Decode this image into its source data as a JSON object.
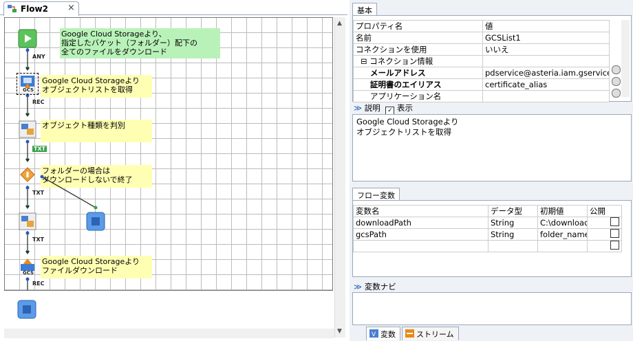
{
  "editor": {
    "tab_label": "Flow2",
    "tab_close": "×"
  },
  "flow": {
    "notes": [
      {
        "text": "Google Cloud Storageより、\n指定したバケット（フォルダー）配下の\n全てのファイルをダウンロード",
        "color": "#b9f2b9"
      },
      {
        "text": "Google Cloud Storageより\nオブジェクトリストを取得",
        "color": "#ffffb3"
      },
      {
        "text": "オブジェクト種類を判別",
        "color": "#ffffb3"
      },
      {
        "text": "フォルダーの場合は\nダウンロードしないで終了",
        "color": "#ffffb3"
      },
      {
        "text": "Google Cloud Storageより\nファイルダウンロード",
        "color": "#ffffb3"
      }
    ],
    "stream_labels": [
      "ANY",
      "REC",
      "TXT",
      "TXT",
      "TXT",
      "REC"
    ],
    "component_labels": [
      "GCS",
      "GCS"
    ]
  },
  "properties": {
    "tab": "基本",
    "header": [
      "プロパティ名",
      "値"
    ],
    "rows": [
      {
        "name": "名前",
        "value": "GCSList1"
      },
      {
        "name": "コネクションを使用",
        "value": "いいえ"
      },
      {
        "name": "コネクション情報",
        "value": ""
      },
      {
        "name": "メールアドレス",
        "value": "pdservice@asteria.iam.gservice..."
      },
      {
        "name": "証明書のエイリアス",
        "value": "certificate_alias"
      },
      {
        "name": "アプリケーション名",
        "value": ""
      }
    ],
    "tree_toggle": "⊟"
  },
  "description": {
    "label": "説明",
    "show_label": "表示",
    "text": "Google Cloud Storageより\nオブジェクトリストを取得"
  },
  "flow_variables": {
    "tab": "フロー変数",
    "headers": [
      "変数名",
      "データ型",
      "初期値",
      "公開"
    ],
    "rows": [
      {
        "name": "downloadPath",
        "type": "String",
        "initial": "C:\\download"
      },
      {
        "name": "gcsPath",
        "type": "String",
        "initial": "folder_name"
      },
      {
        "name": "",
        "type": "",
        "initial": ""
      }
    ]
  },
  "variable_navi": {
    "label": "変数ナビ"
  },
  "bottom_tabs": [
    "変数",
    "ストリーム"
  ]
}
